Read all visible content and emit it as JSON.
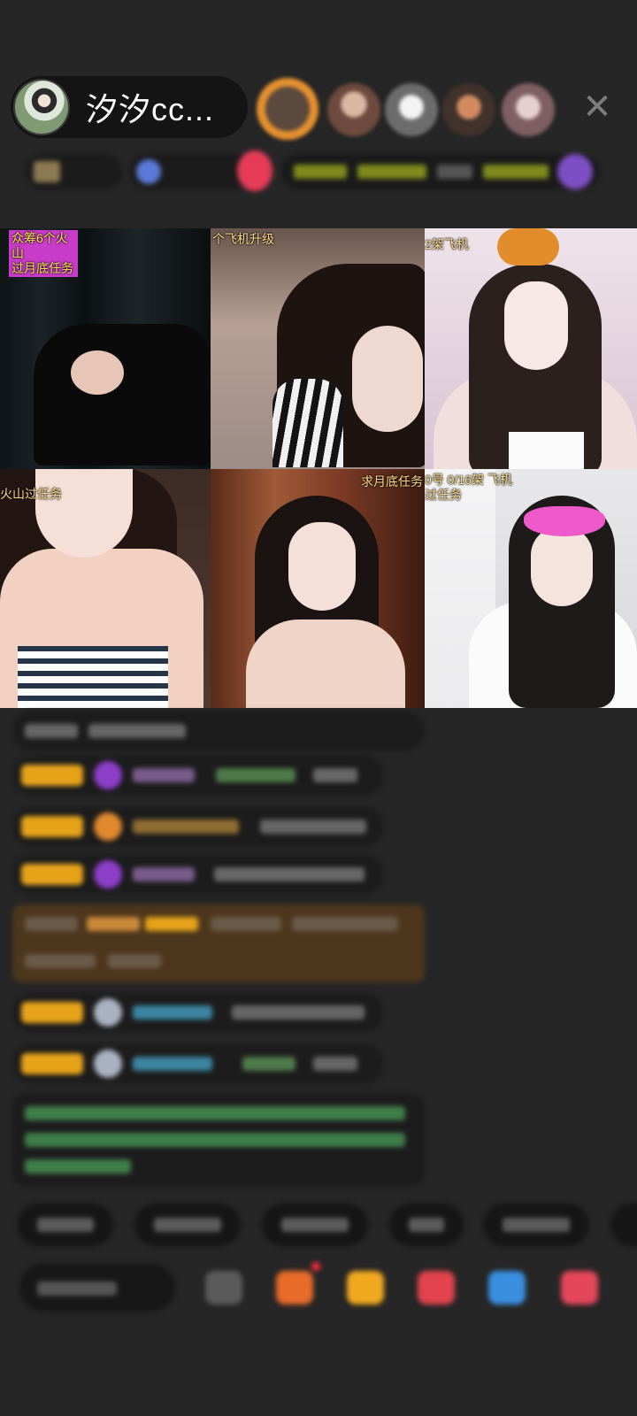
{
  "header": {
    "host_name": "汐汐cc...",
    "close_icon": "close-icon",
    "viewer_avatars": [
      "top-viewer-avatar",
      "viewer-avatar",
      "viewer-avatar",
      "viewer-avatar",
      "viewer-avatar"
    ]
  },
  "info_row": {
    "colors": {
      "badge_gold": "#8d7a52",
      "rank_blue": "#5b7ad8",
      "red_dot": "#e63c58",
      "task_yellow": "#7f8a1d",
      "gem_purple": "#7e4fc4"
    }
  },
  "streams": [
    {
      "label": "众筹6个火山\n过月底任务"
    },
    {
      "label": "个飞机升级"
    },
    {
      "label": "2架飞机"
    },
    {
      "label": "火山过任务"
    },
    {
      "label": "求月底任务"
    },
    {
      "label": "0号  0/16架 飞机\n过任务"
    }
  ],
  "chat": {
    "accent_gold": "#e6a31a",
    "messages_count_visible": 8
  },
  "bottom": {
    "quick_buttons": [
      "",
      "",
      "",
      "",
      ""
    ],
    "toolbar_icons": [
      "grid-icon",
      "gift-box-icon",
      "red-packet-icon",
      "heart-icon",
      "game-icon",
      "shop-icon"
    ]
  }
}
